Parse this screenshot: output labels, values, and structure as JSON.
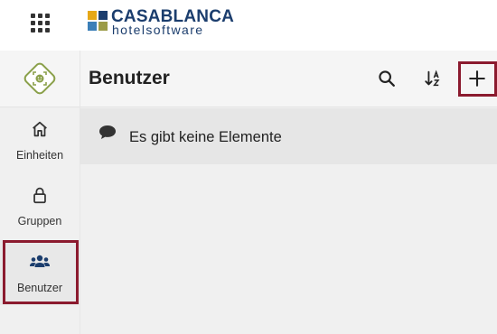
{
  "brand": {
    "name_line1": "CASABLANCA",
    "name_line2": "hotelsoftware",
    "colors": {
      "navy": "#1b3d6d",
      "gold": "#e6a817",
      "blue": "#3b7fb8",
      "olive": "#9c9c48",
      "teal": "#5a8f8a"
    }
  },
  "topbar": {
    "apps_icon": "grid-icon"
  },
  "sidebar": {
    "app_icon": "face-scan-icon",
    "items": [
      {
        "label": "Einheiten",
        "icon": "home-icon",
        "active": false
      },
      {
        "label": "Gruppen",
        "icon": "lock-icon",
        "active": false
      },
      {
        "label": "Benutzer",
        "icon": "users-icon",
        "active": true
      }
    ]
  },
  "main": {
    "title": "Benutzer",
    "actions": [
      {
        "name": "search",
        "icon": "search-icon"
      },
      {
        "name": "sort",
        "icon": "sort-az-icon"
      },
      {
        "name": "add",
        "icon": "plus-icon"
      }
    ],
    "empty_message": "Es gibt keine Elemente",
    "empty_icon": "chat-bubble-icon"
  },
  "highlight_color": "#8b1a2e"
}
